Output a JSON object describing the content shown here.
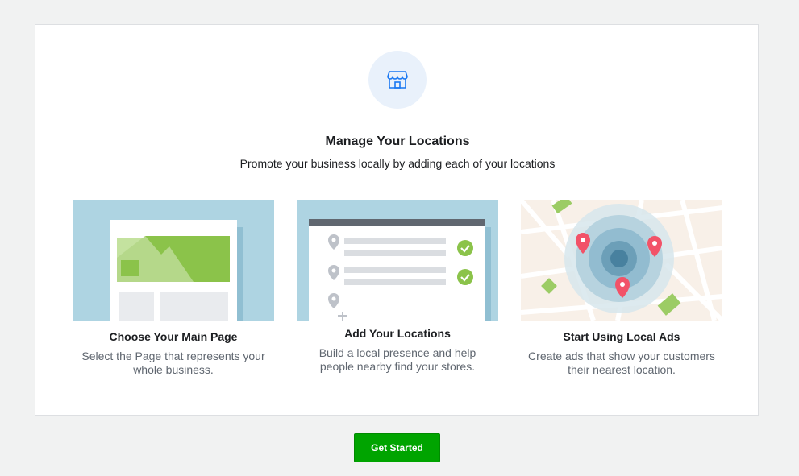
{
  "hero": {
    "icon": "store-icon",
    "title": "Manage Your Locations",
    "subtitle": "Promote your business locally by adding each of your locations"
  },
  "features": [
    {
      "illustration": "main-page-illustration",
      "title": "Choose Your Main Page",
      "description": "Select the Page that represents your whole business."
    },
    {
      "illustration": "locations-list-illustration",
      "title": "Add Your Locations",
      "description": "Build a local presence and help people nearby find your stores."
    },
    {
      "illustration": "local-ads-map-illustration",
      "title": "Start Using Local Ads",
      "description": "Create ads that show your customers their nearest location."
    }
  ],
  "cta": {
    "label": "Get Started"
  },
  "colors": {
    "accent_blue": "#1877f2",
    "cta_green": "#00a400",
    "illus_sky": "#aed4e2",
    "illus_green": "#8bc34a",
    "pin_red": "#f25268"
  }
}
